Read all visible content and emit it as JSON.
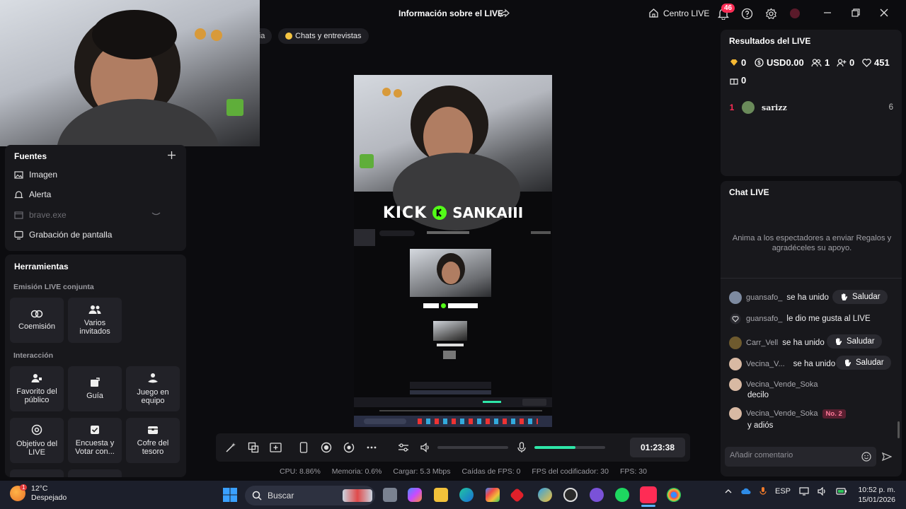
{
  "topbar": {
    "title": "Información sobre el LIVE",
    "centro_live": "Centro LIVE",
    "notif_count": "46"
  },
  "chips": {
    "diaria": "aria",
    "chats": "Chats y entrevistas"
  },
  "fuentes": {
    "title": "Fuentes",
    "items": [
      {
        "label": "Imagen",
        "icon": "image-icon"
      },
      {
        "label": "Alerta",
        "icon": "bell-icon"
      },
      {
        "label": "brave.exe",
        "icon": "window-icon"
      },
      {
        "label": "Grabación de pantalla",
        "icon": "monitor-icon"
      }
    ]
  },
  "herramientas": {
    "title": "Herramientas",
    "section_conjunta": "Emisión LIVE conjunta",
    "section_interaccion": "Interacción",
    "conjunta": [
      {
        "label": "Coemisión",
        "icon": "link-icon"
      },
      {
        "label": "Varios invitados",
        "icon": "users-icon"
      }
    ],
    "interaccion": [
      {
        "label": "Favorito del público",
        "icon": "user-star-icon"
      },
      {
        "label": "Guía",
        "icon": "book-icon"
      },
      {
        "label": "Juego en equipo",
        "icon": "team-icon"
      },
      {
        "label": "Objetivo del LIVE",
        "icon": "target-icon"
      },
      {
        "label": "Encuesta y Votar con...",
        "icon": "poll-icon"
      },
      {
        "label": "Cofre del tesoro",
        "icon": "chest-icon"
      }
    ]
  },
  "preview": {
    "kick_word": "KICK",
    "channel": "SANKAIII"
  },
  "controls": {
    "timer": "01:23:38",
    "volume_level": 0,
    "mic_level": 0.58
  },
  "stats": {
    "cpu": "CPU: 8.86%",
    "memoria": "Memoria: 0.6%",
    "cargar": "Cargar: 5.3 Mbps",
    "caidas": "Caídas de FPS: 0",
    "fps_codificador": "FPS del codificador: 30",
    "fps": "FPS: 30"
  },
  "resultados": {
    "title": "Resultados del LIVE",
    "diamonds": "0",
    "usd": "USD0.00",
    "viewers": "1",
    "followers": "0",
    "likes": "451",
    "gifts": "0",
    "ranking": [
      {
        "rank": "1",
        "name": "sarizz",
        "score": "6"
      }
    ]
  },
  "chat": {
    "title": "Chat LIVE",
    "empty_hint": "Anima a los espectadores a enviar Regalos y agradéceles su apoyo.",
    "saludar": "Saludar",
    "rows": [
      {
        "user": "guansafo_",
        "msg": "se ha unido"
      },
      {
        "user": "guansafo_",
        "msg": "le dio me gusta al LIVE"
      },
      {
        "user": "Carr_Vell",
        "msg": "se ha unido"
      },
      {
        "user": "Vecina_V...",
        "msg": "se ha unido"
      },
      {
        "user": "Vecina_Vende_Soka",
        "msg": "decilo"
      },
      {
        "user": "Vecina_Vende_Soka",
        "msg": "y adiós",
        "badge": "No. 2"
      }
    ],
    "placeholder": "Añadir comentario"
  },
  "taskbar": {
    "temp": "12°C",
    "weather": "Despejado",
    "weather_badge": "1",
    "search": "Buscar",
    "lang": "ESP",
    "time": "10:52 p. m.",
    "date": "15/01/2026"
  }
}
